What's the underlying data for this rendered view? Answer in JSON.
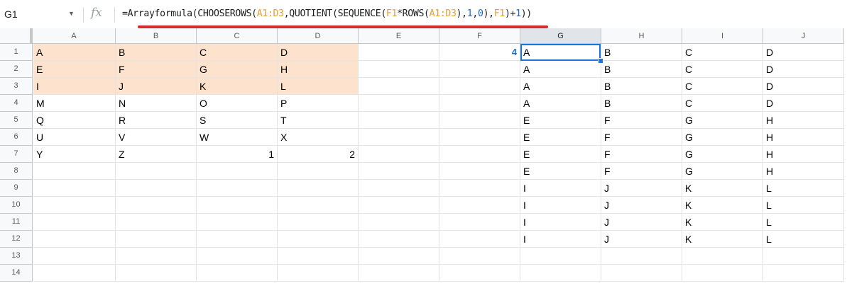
{
  "namebox": {
    "value": "G1"
  },
  "formula_bar": {
    "fx_label": "fx",
    "segments": [
      {
        "t": "=Arrayformula(CHOOSEROWS(",
        "c": ""
      },
      {
        "t": "A1:D3",
        "c": "r"
      },
      {
        "t": ",QUOTIENT(SEQUENCE(",
        "c": ""
      },
      {
        "t": "F1",
        "c": "r"
      },
      {
        "t": "*ROWS(",
        "c": ""
      },
      {
        "t": "A1:D3",
        "c": "r"
      },
      {
        "t": "),",
        "c": ""
      },
      {
        "t": "1",
        "c": "n"
      },
      {
        "t": ",",
        "c": ""
      },
      {
        "t": "0",
        "c": "n"
      },
      {
        "t": "),",
        "c": ""
      },
      {
        "t": "F1",
        "c": "r"
      },
      {
        "t": ")+",
        "c": ""
      },
      {
        "t": "1",
        "c": "n"
      },
      {
        "t": "))",
        "c": ""
      }
    ]
  },
  "colors": {
    "highlight": "#fde3cd",
    "selection": "#1a73e8",
    "annotation": "#d92b2b"
  },
  "columns": [
    "A",
    "B",
    "C",
    "D",
    "E",
    "F",
    "G",
    "H",
    "I",
    "J"
  ],
  "selected_column": "G",
  "rows": [
    "1",
    "2",
    "3",
    "4",
    "5",
    "6",
    "7",
    "8",
    "9",
    "10",
    "11",
    "12",
    "13",
    "14"
  ],
  "cells": [
    [
      "A",
      "B",
      "C",
      "D",
      "",
      "4",
      "A",
      "B",
      "C",
      "D"
    ],
    [
      "E",
      "F",
      "G",
      "H",
      "",
      "",
      "A",
      "B",
      "C",
      "D"
    ],
    [
      "I",
      "J",
      "K",
      "L",
      "",
      "",
      "A",
      "B",
      "C",
      "D"
    ],
    [
      "M",
      "N",
      "O",
      "P",
      "",
      "",
      "A",
      "B",
      "C",
      "D"
    ],
    [
      "Q",
      "R",
      "S",
      "T",
      "",
      "",
      "E",
      "F",
      "G",
      "H"
    ],
    [
      "U",
      "V",
      "W",
      "X",
      "",
      "",
      "E",
      "F",
      "G",
      "H"
    ],
    [
      "Y",
      "Z",
      "1",
      "2",
      "",
      "",
      "E",
      "F",
      "G",
      "H"
    ],
    [
      "",
      "",
      "",
      "",
      "",
      "",
      "E",
      "F",
      "G",
      "H"
    ],
    [
      "",
      "",
      "",
      "",
      "",
      "",
      "I",
      "J",
      "K",
      "L"
    ],
    [
      "",
      "",
      "",
      "",
      "",
      "",
      "I",
      "J",
      "K",
      "L"
    ],
    [
      "",
      "",
      "",
      "",
      "",
      "",
      "I",
      "J",
      "K",
      "L"
    ],
    [
      "",
      "",
      "",
      "",
      "",
      "",
      "I",
      "J",
      "K",
      "L"
    ],
    [
      "",
      "",
      "",
      "",
      "",
      "",
      "",
      "",
      "",
      ""
    ],
    [
      "",
      "",
      "",
      "",
      "",
      "",
      "",
      "",
      "",
      ""
    ]
  ],
  "highlighted_range": "A1:D3",
  "selected_cell": "G1"
}
